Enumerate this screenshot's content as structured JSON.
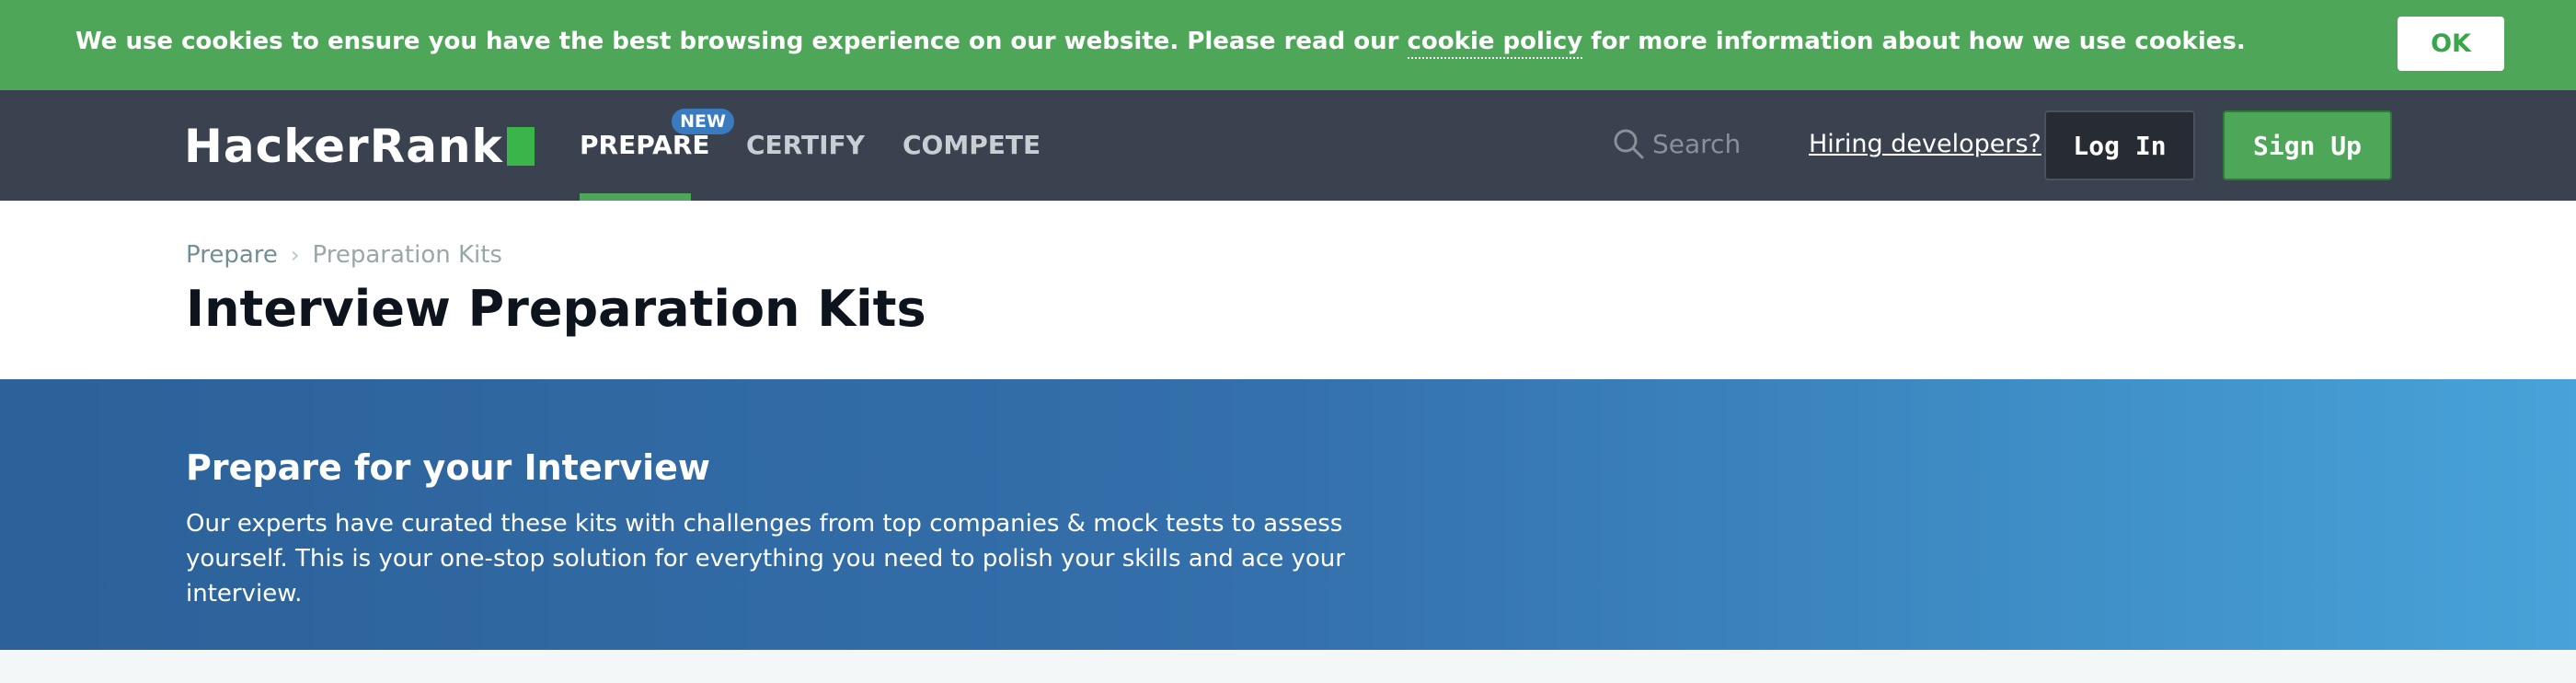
{
  "cookie_banner": {
    "text_before": "We use cookies to ensure you have the best browsing experience on our website. Please read our ",
    "link_text": "cookie policy",
    "text_after": " for more information about how we use cookies.",
    "ok_label": "OK",
    "background": "#4ea759"
  },
  "nav": {
    "logo_text": "HackerRank",
    "items": [
      {
        "label": "PREPARE",
        "active": true,
        "badge": "NEW"
      },
      {
        "label": "CERTIFY",
        "active": false
      },
      {
        "label": "COMPETE",
        "active": false
      }
    ],
    "search_placeholder": "Search",
    "hiring_link": "Hiring developers?",
    "login_label": "Log In",
    "signup_label": "Sign Up",
    "background": "#39424e",
    "accent": "#4ea759",
    "icons": {
      "search": "search-icon"
    }
  },
  "breadcrumb": {
    "items": [
      "Prepare",
      "Preparation Kits"
    ],
    "separator_icon": "chevron-right-icon"
  },
  "page": {
    "title": "Interview Preparation Kits"
  },
  "hero": {
    "title": "Prepare for your Interview",
    "text": "Our experts have curated these kits with challenges from top companies & mock tests to assess yourself. This is your one-stop solution for everything you need to polish your skills and ace your interview.",
    "gradient_start": "#2c6199",
    "gradient_end": "#47a3d9"
  }
}
